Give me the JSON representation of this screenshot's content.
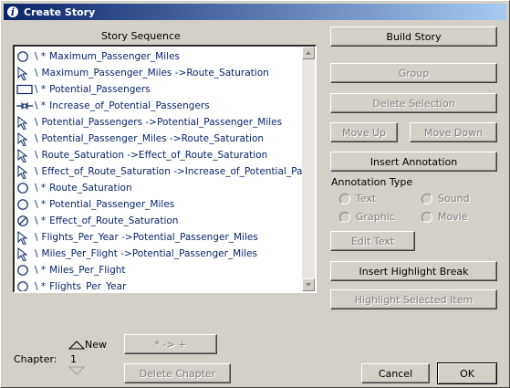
{
  "window": {
    "title": "Create Story"
  },
  "story_sequence": {
    "header": "Story Sequence",
    "items": [
      {
        "icon": "circle-icon",
        "prefix": "\\ *",
        "label": "Maximum_Passenger_Miles"
      },
      {
        "icon": "link-arrow-icon",
        "prefix": "\\",
        "label": "Maximum_Passenger_Miles ->Route_Saturation"
      },
      {
        "icon": "rectangle-icon",
        "prefix": "\\ *",
        "label": "Potential_Passengers"
      },
      {
        "icon": "flow-valve-icon",
        "prefix": "\\ *",
        "label": "Increase_of_Potential_Passengers"
      },
      {
        "icon": "link-arrow-icon",
        "prefix": "\\",
        "label": "Potential_Passengers ->Potential_Passenger_Miles"
      },
      {
        "icon": "link-arrow-icon",
        "prefix": "\\",
        "label": "Potential_Passenger_Miles ->Route_Saturation"
      },
      {
        "icon": "link-arrow-icon",
        "prefix": "\\",
        "label": "Route_Saturation ->Effect_of_Route_Saturation"
      },
      {
        "icon": "link-arrow-icon",
        "prefix": "\\",
        "label": "Effect_of_Route_Saturation ->Increase_of_Potential_Pa..."
      },
      {
        "icon": "circle-icon",
        "prefix": "\\ *",
        "label": "Route_Saturation"
      },
      {
        "icon": "circle-icon",
        "prefix": "\\ *",
        "label": "Potential_Passenger_Miles"
      },
      {
        "icon": "circle-slash-icon",
        "prefix": "\\ *",
        "label": "Effect_of_Route_Saturation"
      },
      {
        "icon": "link-arrow-icon",
        "prefix": "\\",
        "label": "Flights_Per_Year ->Potential_Passenger_Miles"
      },
      {
        "icon": "link-arrow-icon",
        "prefix": "\\",
        "label": "Miles_Per_Flight ->Potential_Passenger_Miles"
      },
      {
        "icon": "circle-icon",
        "prefix": "\\ *",
        "label": "Miles_Per_Flight"
      },
      {
        "icon": "circle-icon",
        "prefix": "\\ *",
        "label": "Flights_Per_Year"
      }
    ]
  },
  "buttons": {
    "build_story": "Build Story",
    "group": "Group",
    "delete_selection": "Delete Selection",
    "move_up": "Move Up",
    "move_down": "Move Down",
    "insert_annotation": "Insert Annotation",
    "edit_text": "Edit Text",
    "insert_highlight_break": "Insert Highlight Break",
    "highlight_selected_item": "Highlight Selected Item",
    "arrow_plus": "* -> +",
    "delete_chapter": "Delete Chapter",
    "cancel": "Cancel",
    "ok": "OK"
  },
  "annotation": {
    "label": "Annotation Type",
    "text": "Text",
    "sound": "Sound",
    "graphic": "Graphic",
    "movie": "Movie"
  },
  "chapter": {
    "label": "Chapter:",
    "value": "1",
    "new_label": "New"
  }
}
